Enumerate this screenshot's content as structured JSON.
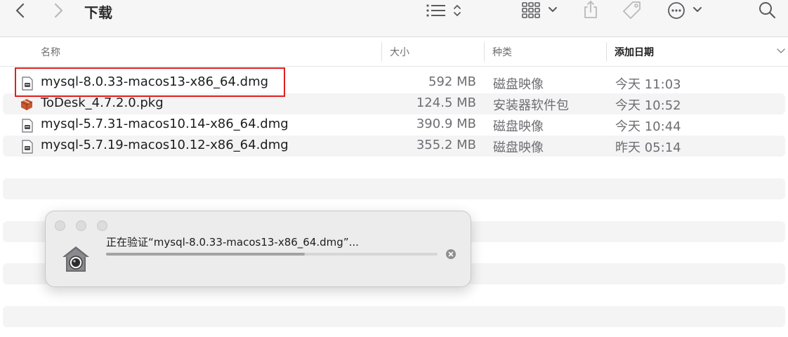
{
  "toolbar": {
    "title": "下载"
  },
  "columns": {
    "name": "名称",
    "size": "大小",
    "kind": "种类",
    "date": "添加日期"
  },
  "files": [
    {
      "name": "mysql-8.0.33-macos13-x86_64.dmg",
      "size": "592 MB",
      "kind": "磁盘映像",
      "date": "今天 11:03",
      "icon": "disk-image-icon"
    },
    {
      "name": "ToDesk_4.7.2.0.pkg",
      "size": "124.5 MB",
      "kind": "安装器软件包",
      "date": "今天 10:52",
      "icon": "package-icon"
    },
    {
      "name": "mysql-5.7.31-macos10.14-x86_64.dmg",
      "size": "390.9 MB",
      "kind": "磁盘映像",
      "date": "今天 10:44",
      "icon": "disk-image-icon"
    },
    {
      "name": "mysql-5.7.19-macos10.12-x86_64.dmg",
      "size": "355.2 MB",
      "kind": "磁盘映像",
      "date": "昨天 05:14",
      "icon": "disk-image-icon"
    }
  ],
  "highlight_color": "#e0201f",
  "verify_dialog": {
    "message": "正在验证“mysql-8.0.33-macos13-x86_64.dmg”...",
    "progress": 0.6
  }
}
